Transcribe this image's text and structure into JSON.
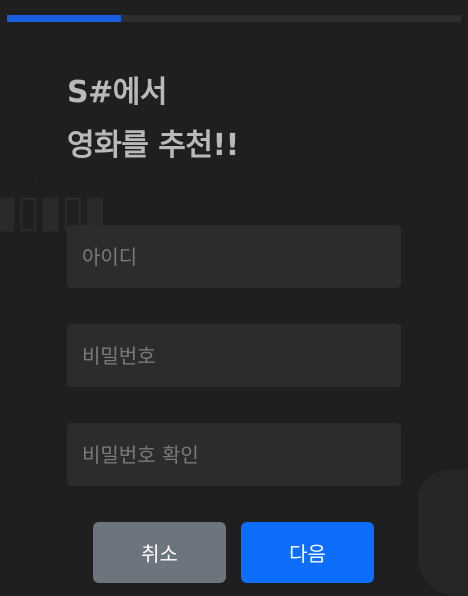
{
  "progress": {
    "value": 0.25,
    "color": "#1a5fe0"
  },
  "title": {
    "line1": "S#에서",
    "line2": "영화를 추천!!"
  },
  "form": {
    "id_placeholder": "아이디",
    "password_placeholder": "비밀번호",
    "password_confirm_placeholder": "비밀번호 확인"
  },
  "buttons": {
    "cancel": "취소",
    "next": "다음"
  },
  "colors": {
    "primary": "#0d6efd",
    "secondary": "#6c757d",
    "background": "#1f1f1f"
  }
}
